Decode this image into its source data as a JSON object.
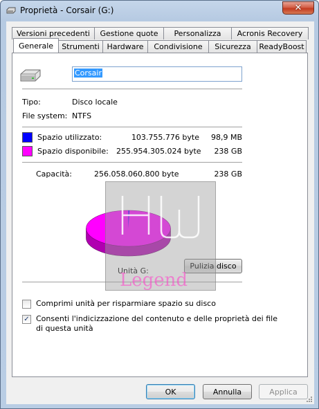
{
  "window": {
    "title": "Proprietà - Corsair (G:)",
    "close_label": "✕"
  },
  "tabs_top": [
    "Versioni precedenti",
    "Gestione quote",
    "Personalizza",
    "Acronis Recovery"
  ],
  "tabs_bottom": [
    "Generale",
    "Strumenti",
    "Hardware",
    "Condivisione",
    "Sicurezza",
    "ReadyBoost"
  ],
  "general": {
    "drive_name": "Corsair",
    "tipo_label": "Tipo:",
    "tipo_value": "Disco locale",
    "fs_label": "File system:",
    "fs_value": "NTFS",
    "used_label": "Spazio utilizzato:",
    "used_bytes": "103.755.776 byte",
    "used_size": "98,9 MB",
    "free_label": "Spazio disponibile:",
    "free_bytes": "255.954.305.024 byte",
    "free_size": "238 GB",
    "cap_label": "Capacità:",
    "cap_bytes": "256.058.060.800 byte",
    "cap_size": "238 GB",
    "drive_label": "Unità G:",
    "cleanup_label": "Pulizia disco",
    "compress_label": "Comprimi unità per risparmiare spazio su disco",
    "index_label_line1": "Consenti l'indicizzazione del contenuto e delle proprietà dei file",
    "index_label_line2": "di questa unità",
    "compress_checked": false,
    "index_checked": true,
    "used_fraction": 0.000405
  },
  "colors": {
    "used": "#0000ff",
    "free": "#ff00ff",
    "free_dark": "#b000b0"
  },
  "buttons": {
    "ok": "OK",
    "cancel": "Annulla",
    "apply": "Applica"
  },
  "watermark": {
    "text_top": "HW",
    "text_bottom": "Legend"
  }
}
